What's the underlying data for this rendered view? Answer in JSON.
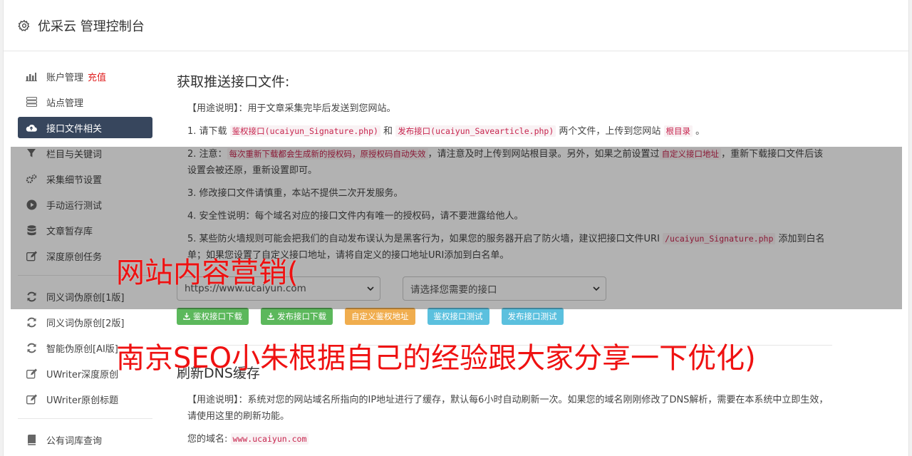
{
  "header": {
    "title": "优采云 管理控制台",
    "icon": "gear-icon"
  },
  "sidebar": {
    "group1": [
      {
        "icon": "bar-chart-icon",
        "label": "账户管理",
        "extra": "充值"
      },
      {
        "icon": "server-icon",
        "label": "站点管理"
      },
      {
        "icon": "cloud-upload-icon",
        "label": "接口文件相关",
        "active": true
      },
      {
        "icon": "filter-icon",
        "label": "栏目与关键词"
      },
      {
        "icon": "cogs-icon",
        "label": "采集细节设置"
      },
      {
        "icon": "play-circle-icon",
        "label": "手动运行测试"
      },
      {
        "icon": "database-icon",
        "label": "文章暂存库"
      },
      {
        "icon": "edit-icon",
        "label": "深度原创任务"
      }
    ],
    "group2": [
      {
        "icon": "refresh-icon",
        "label": "同义词伪原创[1版]"
      },
      {
        "icon": "refresh-icon",
        "label": "同义词伪原创[2版]"
      },
      {
        "icon": "refresh-icon",
        "label": "智能伪原创[AI版]"
      },
      {
        "icon": "edit-icon",
        "label": "UWriter深度原创"
      },
      {
        "icon": "edit-icon",
        "label": "UWriter原创标题"
      }
    ],
    "group3": [
      {
        "icon": "book-icon",
        "label": "公有词库查询"
      }
    ]
  },
  "section1": {
    "title": "获取推送接口文件:",
    "usage": "【用途说明】：用于文章采集完毕后发送到您网站。",
    "step1_a": "1. 请下载 ",
    "step1_code1": "鉴权接口(ucaiyun_Signature.php)",
    "step1_b": " 和 ",
    "step1_code2": "发布接口(ucaiyun_Savearticle.php)",
    "step1_c": " 两个文件，上传到您网站 ",
    "step1_code3": "根目录",
    "step1_d": " 。",
    "step2_a": "2. 注意：",
    "step2_code1": "每次重新下载都会生成新的授权码，原授权码自动失效",
    "step2_b": "，请注意及时上传到网站根目录。另外，如果之前设置过",
    "step2_code2": "自定义接口地址",
    "step2_c": "，重新下载接口文件后该设置会被还原，重新设置即可。",
    "step3": "3. 修改接口文件请慎重，本站不提供二次开发服务。",
    "step4": "4. 安全性说明：每个域名对应的接口文件内有唯一的授权码，请不要泄露给他人。",
    "step5_a": "5. 某些防火墙规则可能会把我们的自动发布误认为是黑客行为，如果您的服务器开启了防火墙，建议把接口文件URI ",
    "step5_code": "/ucaiyun_Signature.php",
    "step5_b": " 添加到白名单；如果您设置了自定义接口地址，请将自定义的接口地址URI添加到白名单。",
    "site_select": "https://www.ucaiyun.com",
    "api_select": "请选择您需要的接口",
    "buttons": [
      "鉴权接口下载",
      "发布接口下载",
      "自定义鉴权地址",
      "鉴权接口测试",
      "发布接口测试"
    ]
  },
  "section2": {
    "title": "刷新DNS缓存",
    "usage": "【用途说明】：系统对您的网站域名所指向的IP地址进行了缓存，默认每6小时自动刷新一次。如果您的域名刚刚修改了DNS解析，需要在本系统中立即生效，请使用这里的刷新功能。",
    "domain_label": "您的域名: ",
    "domain_value": "www.ucaiyun.com"
  },
  "watermark": {
    "line1": "网站内容营销(",
    "line2": "南京SEO小朱根据自己的经验跟大家分享一下优化)"
  },
  "colors": {
    "active_bg": "#37465d",
    "red": "#ef1111",
    "green": "#5cb85c",
    "orange": "#f0ad4e",
    "blue": "#5bc0de"
  }
}
